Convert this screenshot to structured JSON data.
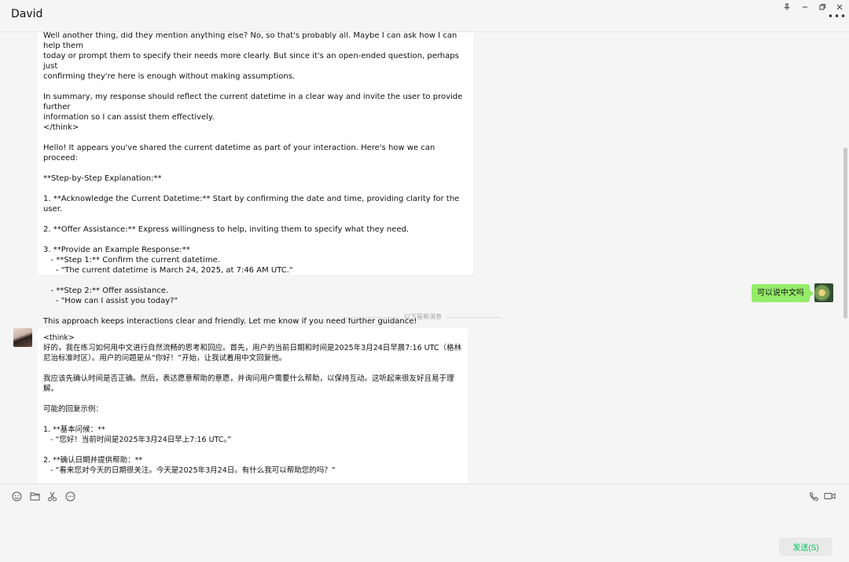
{
  "window": {
    "title": "David"
  },
  "messages": [
    {
      "text": "Well another thing, did they mention anything else? No, so that's probably all. Maybe I can ask how I can help them\ntoday or prompt them to specify their needs more clearly. But since it's an open-ended question, perhaps just\nconfirming they're here is enough without making assumptions.\n\nIn summary, my response should reflect the current datetime in a clear way and invite the user to provide further\ninformation so I can assist them effectively.\n</think>\n\nHello! It appears you've shared the current datetime as part of your interaction. Here's how we can proceed:\n\n**Step-by-Step Explanation:**\n\n1. **Acknowledge the Current Datetime:** Start by confirming the date and time, providing clarity for the user.\n\n2. **Offer Assistance:** Express willingness to help, inviting them to specify what they need.\n\n3. **Provide an Example Response:**\n   - **Step 1:** Confirm the current datetime.\n     - \"The current datetime is March 24, 2025, at 7:46 AM UTC.\"\n\n   - **Step 2:** Offer assistance.\n     - \"How can I assist you today?\"\n\nThis approach keeps interactions clear and friendly. Let me know if you need further guidance!"
    },
    {
      "text": "可以说中文吗"
    },
    {
      "text": "<think>\n好的，我在练习如何用中文进行自然流畅的思考和回应。首先，用户的当前日期和时间是2025年3月24日早晨7:16 UTC（格林\n尼治标准时区）。用户的问题是从“你好！”开始，让我试着用中文回复他。\n\n我应该先确认时间是否正确。然后，表达愿意帮助的意愿，并询问用户需要什么帮助，以保持互动。这听起来很友好且易于理\n解。\n\n可能的回复示例：\n\n1. **基本问候：**\n   - “您好！当前时间是2025年3月24日早上7:16 UTC。”\n\n2. **确认日期并提供帮助：**\n   - “看来您对今天的日期很关注。今天是2025年3月24日。有什么我可以帮助您的吗？”"
    }
  ],
  "divider": {
    "label": "以下是新消息"
  },
  "toolbar": {
    "icons": [
      "emoji-icon",
      "folder-icon",
      "scissors-icon",
      "chat-history-icon",
      "phone-icon",
      "video-icon"
    ]
  },
  "send": {
    "label": "发送(S)"
  },
  "colors": {
    "my_bubble": "#95ec69",
    "send_text": "#07c160",
    "background": "#f5f5f5"
  }
}
